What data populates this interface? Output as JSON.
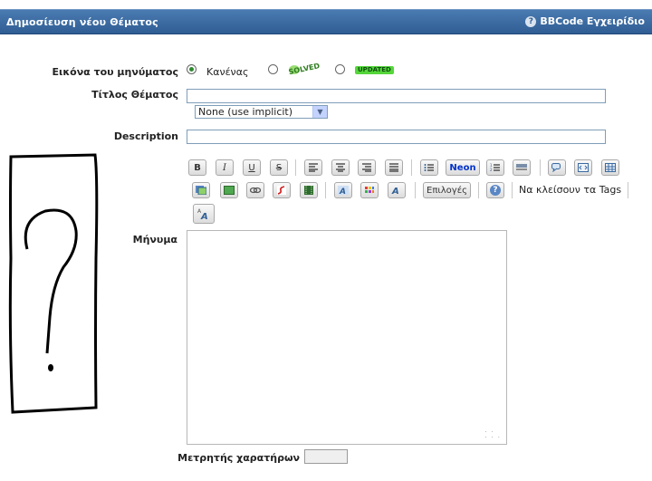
{
  "header": {
    "title": "Δημοσίευση νέου Θέματος",
    "bbcode_link": "BBCode Εγχειρίδιο"
  },
  "form": {
    "post_icon_label": "Εικόνα του μηνύματος",
    "icon_options": [
      {
        "label": "Κανένας",
        "selected": true
      },
      {
        "label": "SOLVED",
        "selected": false
      },
      {
        "label": "UPDATED",
        "selected": false
      }
    ],
    "topic_title_label": "Τίτλος Θέματος",
    "topic_title_value": "",
    "prefix_select_value": "None (use implicit)",
    "description_label": "Description",
    "description_value": "",
    "message_label": "Μήνυμα",
    "message_value": "",
    "char_counter_label": "Μετρητής χαρατήρων"
  },
  "toolbar": {
    "bold": "B",
    "italic": "I",
    "underline": "U",
    "strike": "S",
    "neon": "Neon",
    "options": "Επιλογές",
    "close_tags": "Να κλείσουν τα Tags"
  },
  "colors": {
    "header_bg": "#3b6aa0",
    "neon_text": "#0033cc",
    "solved_green": "#6fcf3a"
  }
}
